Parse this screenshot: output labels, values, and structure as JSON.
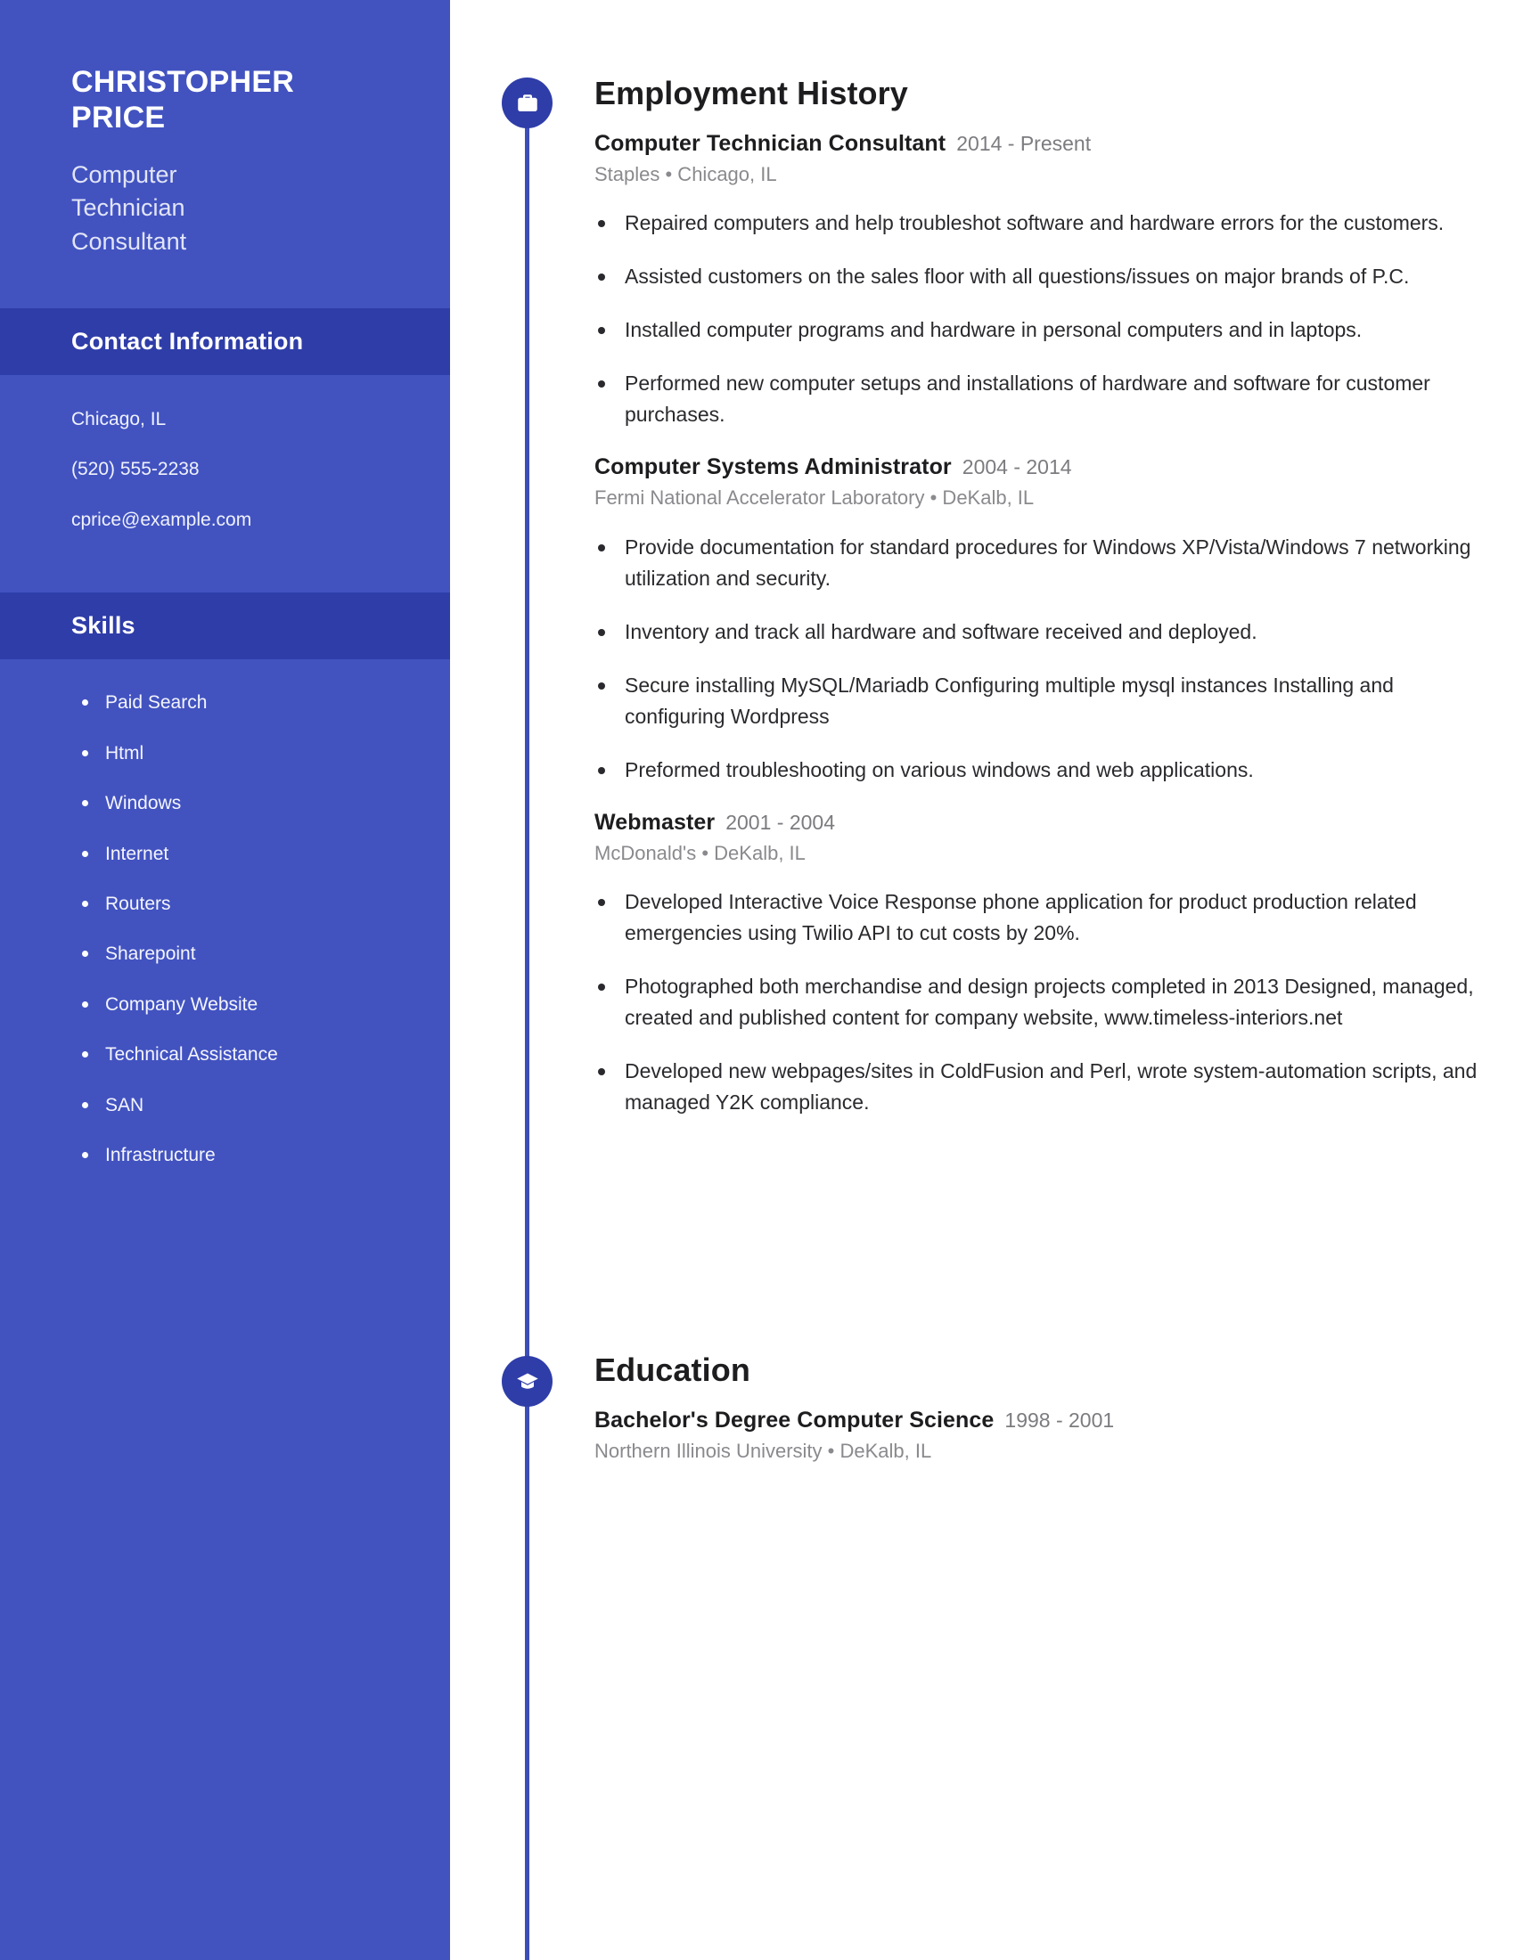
{
  "theme": {
    "sidebar_bg": "#4253c0",
    "band_bg": "#2f3da8",
    "accent": "#2f3da8",
    "timeline_line": "#3d4eb8",
    "text_dark": "#1d1d1f",
    "text_muted": "#8a8a8e"
  },
  "sidebar": {
    "full_name": "CHRISTOPHER\nPRICE",
    "job_subtitle": "Computer\nTechnician\nConsultant",
    "contact": {
      "heading": "Contact Information",
      "location": "Chicago, IL",
      "phone": "(520) 555-2238",
      "email": "cprice@example.com"
    },
    "skills": {
      "heading": "Skills",
      "items": [
        "Paid Search",
        "Html",
        "Windows",
        "Internet",
        "Routers",
        "Sharepoint",
        "Company Website",
        "Technical Assistance",
        "SAN",
        "Infrastructure"
      ]
    }
  },
  "main": {
    "employment": {
      "heading": "Employment History",
      "icon": "briefcase-icon",
      "entries": [
        {
          "title": "Computer Technician Consultant",
          "dates": "2014 - Present",
          "meta": "Staples  •  Chicago, IL",
          "bullets": [
            "Repaired computers and help troubleshot software and hardware errors for the customers.",
            "Assisted customers on the sales floor with all questions/issues on major brands of P.C.",
            "Installed computer programs and hardware in personal computers and in laptops.",
            "Performed new computer setups and installations of hardware and software for customer purchases."
          ]
        },
        {
          "title": "Computer Systems Administrator",
          "dates": "2004 - 2014",
          "meta": "Fermi National Accelerator Laboratory  •  DeKalb, IL",
          "bullets": [
            "Provide documentation for standard procedures for Windows XP/Vista/Windows 7 networking utilization and security.",
            "Inventory and track all hardware and software received and deployed.",
            "Secure installing MySQL/Mariadb Configuring multiple mysql instances Installing and configuring Wordpress",
            "Preformed troubleshooting on various windows and web applications."
          ]
        },
        {
          "title": "Webmaster",
          "dates": "2001 - 2004",
          "meta": "McDonald's  •  DeKalb, IL",
          "bullets": [
            "Developed Interactive Voice Response phone application for product production related emergencies using Twilio API to cut costs by 20%.",
            "Photographed both merchandise and design projects completed in 2013 Designed, managed, created and published content for company website, www.timeless-interiors.net",
            "Developed new webpages/sites in ColdFusion and Perl, wrote system-automation scripts, and managed Y2K compliance."
          ]
        }
      ]
    },
    "education": {
      "heading": "Education",
      "icon": "graduation-cap-icon",
      "entries": [
        {
          "title": "Bachelor's Degree Computer Science",
          "dates": "1998 - 2001",
          "meta": "Northern Illinois University  •  DeKalb, IL"
        }
      ]
    }
  }
}
